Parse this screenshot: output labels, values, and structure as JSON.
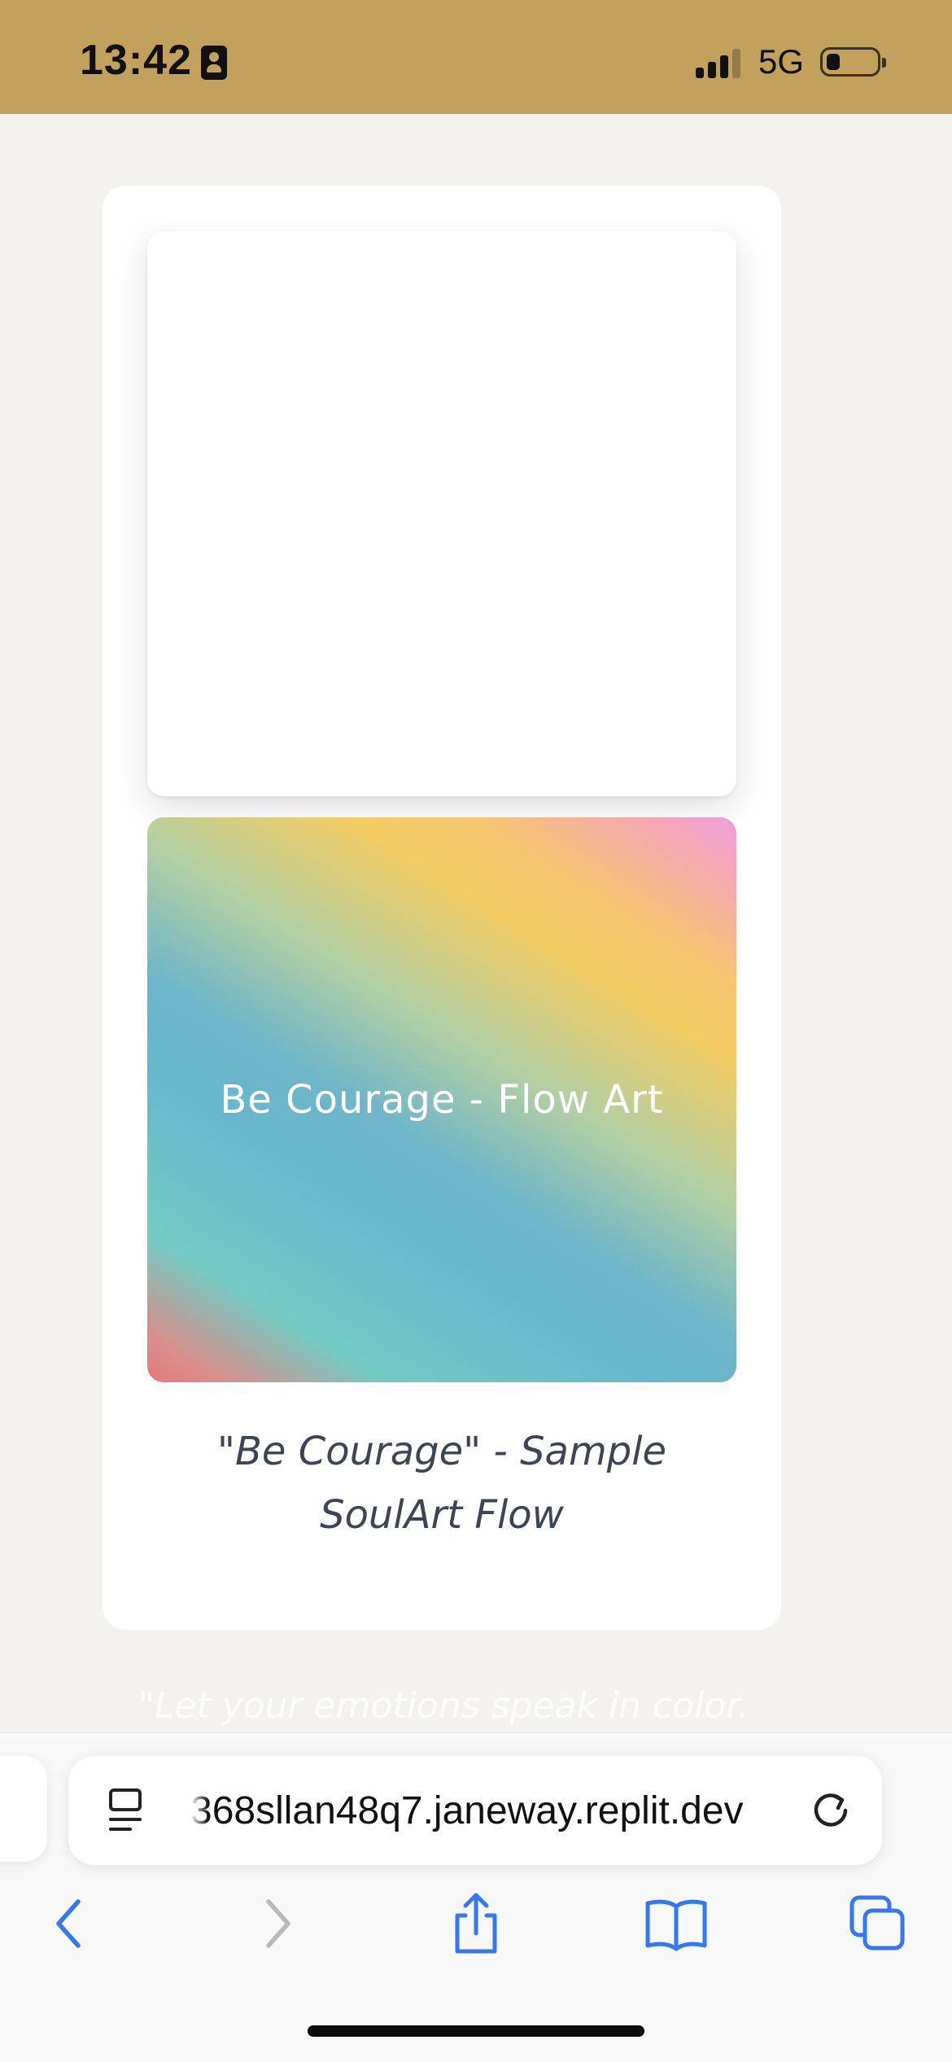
{
  "status_bar": {
    "time": "13:42",
    "network": "5G",
    "icons": [
      "idcard-icon",
      "signal-icon",
      "battery-icon"
    ],
    "signal_bars_filled": 3,
    "signal_bars_total": 4,
    "battery_level": 0.2
  },
  "main": {
    "flow_art_label": "Be Courage - Flow Art",
    "caption_line1": "\"Be Courage\" - Sample",
    "caption_line2": "SoulArt Flow",
    "quote": "\"Let your emotions speak in color."
  },
  "browser": {
    "url_text": "368sllan48q7.janeway.replit.dev",
    "toolbar_icons": [
      "back-icon",
      "forward-icon",
      "share-icon",
      "bookmarks-icon",
      "tabs-icon"
    ]
  },
  "colors": {
    "status_bar": "#c2a15c",
    "page_background": "#f3f2ee",
    "ios_blue": "#3478f6",
    "caption_text": "#3d4453"
  }
}
